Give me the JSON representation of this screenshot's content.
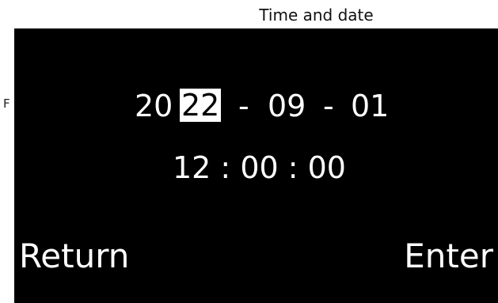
{
  "header": {
    "caption": "Time and date"
  },
  "side": {
    "letter": "F"
  },
  "screen": {
    "date": {
      "year_prefix": "20",
      "year_selected": "22",
      "separator_1": "-",
      "month": "09",
      "separator_2": "-",
      "day": "01"
    },
    "time": "12 : 00 : 00",
    "buttons": {
      "return_label": "Return",
      "enter_label": "Enter"
    }
  }
}
